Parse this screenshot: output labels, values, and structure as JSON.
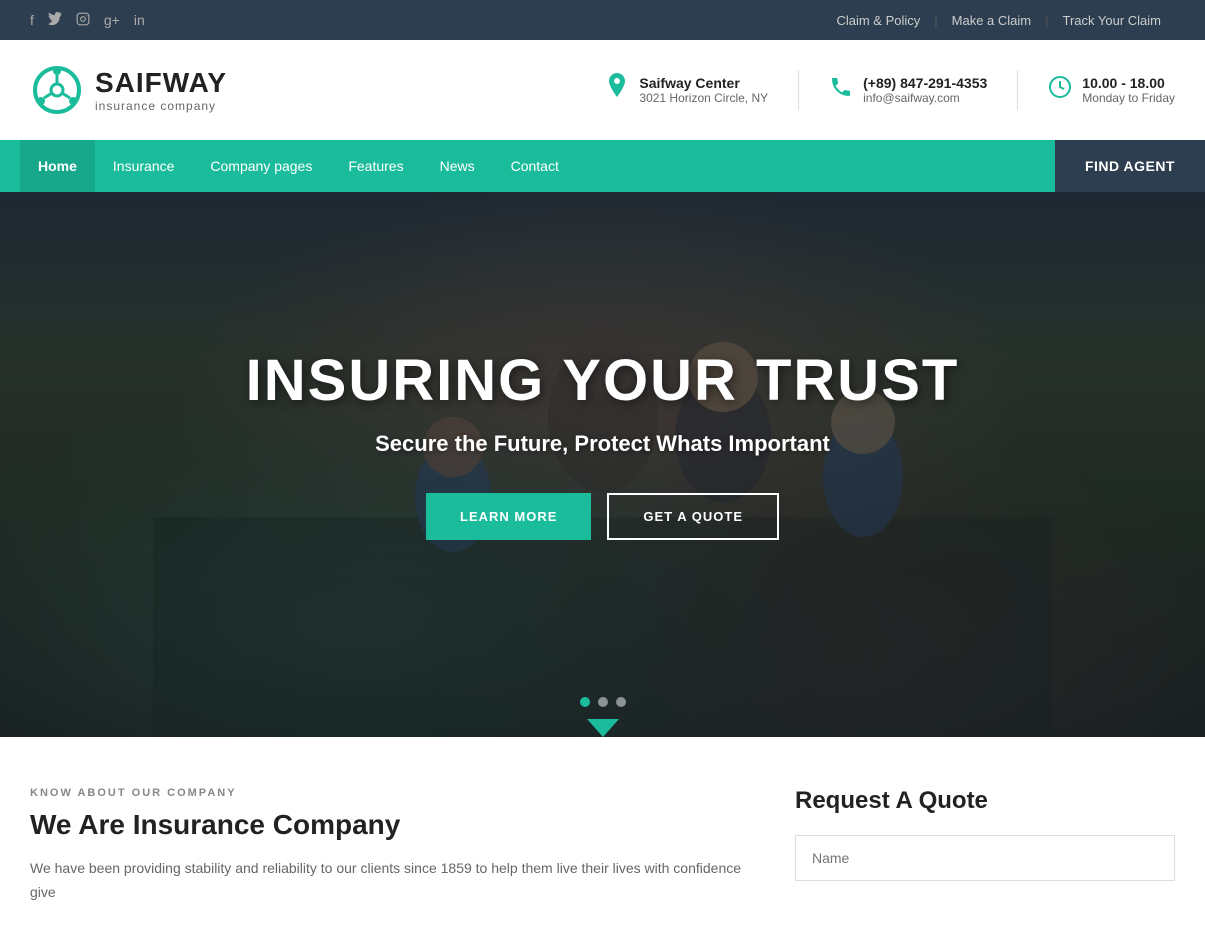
{
  "topbar": {
    "social": [
      {
        "name": "facebook-icon",
        "glyph": "f"
      },
      {
        "name": "twitter-icon",
        "glyph": "t"
      },
      {
        "name": "instagram-icon",
        "glyph": "ig"
      },
      {
        "name": "googleplus-icon",
        "glyph": "g+"
      },
      {
        "name": "linkedin-icon",
        "glyph": "in"
      }
    ],
    "links": [
      {
        "label": "Claim & Policy",
        "name": "claim-policy-link"
      },
      {
        "label": "Make a Claim",
        "name": "make-claim-link"
      },
      {
        "label": "Track Your Claim",
        "name": "track-claim-link"
      }
    ]
  },
  "header": {
    "logo": {
      "name": "SAIFWAY",
      "tagline": "insurance company"
    },
    "contacts": [
      {
        "name": "address-contact",
        "icon": "📍",
        "label": "Saifway Center",
        "detail": "3021 Horizon Circle, NY"
      },
      {
        "name": "phone-contact",
        "icon": "📞",
        "label": "(+89) 847-291-4353",
        "detail": "info@saifway.com"
      },
      {
        "name": "hours-contact",
        "icon": "🕐",
        "label": "10.00 - 18.00",
        "detail": "Monday to Friday"
      }
    ]
  },
  "navbar": {
    "items": [
      {
        "label": "Home",
        "name": "nav-home",
        "active": true
      },
      {
        "label": "Insurance",
        "name": "nav-insurance"
      },
      {
        "label": "Company pages",
        "name": "nav-company"
      },
      {
        "label": "Features",
        "name": "nav-features"
      },
      {
        "label": "News",
        "name": "nav-news"
      },
      {
        "label": "Contact",
        "name": "nav-contact"
      }
    ],
    "cta": "FIND AGENT"
  },
  "hero": {
    "title": "INSURING YOUR TRUST",
    "subtitle": "Secure the Future, Protect Whats Important",
    "btn_learn": "LEARN MORE",
    "btn_quote": "GET A QUOTE",
    "dots": [
      {
        "active": true
      },
      {
        "active": false
      },
      {
        "active": false
      }
    ]
  },
  "company_section": {
    "tag": "KNOW ABOUT OUR COMPANY",
    "title": "We Are Insurance Company",
    "body": "We have been providing stability and reliability to our clients since 1859 to help them live their lives with confidence give"
  },
  "quote_form": {
    "title": "Request A Quote",
    "name_placeholder": "Name"
  }
}
